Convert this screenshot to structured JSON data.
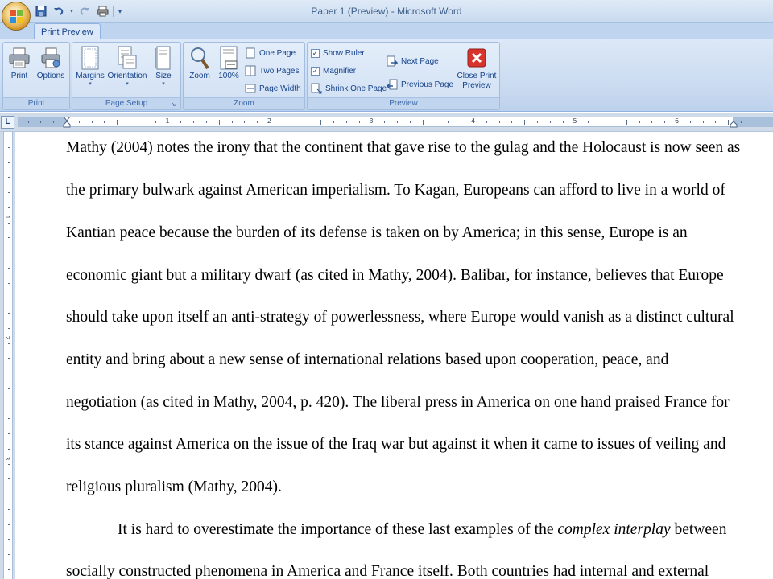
{
  "window": {
    "title": "Paper 1 (Preview) - Microsoft Word"
  },
  "tabs": {
    "active": "Print Preview"
  },
  "ribbon": {
    "print_group": {
      "label": "Print",
      "print": "Print",
      "options": "Options"
    },
    "page_setup_group": {
      "label": "Page Setup",
      "margins": "Margins",
      "orientation": "Orientation",
      "size": "Size"
    },
    "zoom_group": {
      "label": "Zoom",
      "zoom": "Zoom",
      "hundred": "100%",
      "one_page": "One Page",
      "two_pages": "Two Pages",
      "page_width": "Page Width"
    },
    "preview_group": {
      "label": "Preview",
      "show_ruler": "Show Ruler",
      "show_ruler_checked": true,
      "magnifier": "Magnifier",
      "magnifier_checked": true,
      "shrink_one_page": "Shrink One Page",
      "next_page": "Next Page",
      "previous_page": "Previous Page",
      "close_line1": "Close Print",
      "close_line2": "Preview"
    }
  },
  "ruler": {
    "corner": "L",
    "numbers": [
      "1",
      "2",
      "3",
      "4",
      "5",
      "6"
    ],
    "vertical_numbers": [
      "1",
      "2",
      "3"
    ]
  },
  "document": {
    "lines": [
      "Mathy (2004) notes the irony that the continent that gave rise to the gulag and the Holocaust is now seen as",
      "the primary bulwark against American imperialism.  To Kagan, Europeans can afford to live in a world of",
      "Kantian peace because the burden of its defense is taken on by America; in this sense, Europe is an",
      "economic giant but a military dwarf (as cited in Mathy, 2004).  Balibar, for instance, believes that Europe",
      "should take upon itself an anti-strategy of powerlessness, where Europe would vanish as a distinct cultural",
      "entity and bring about a new sense of international relations based upon cooperation, peace, and",
      "negotiation (as cited in Mathy, 2004, p. 420).  The liberal press in America on one hand praised France for",
      "its stance against America on the issue of the Iraq war but against it when it came to issues of veiling and",
      "religious pluralism (Mathy, 2004)."
    ],
    "para2_line1_before": "It is hard to overestimate the importance of these last examples of the ",
    "para2_line1_italic": "complex interplay",
    "para2_line1_after": " between",
    "para2_line2": "socially constructed phenomena in America and France itself.  Both countries had internal and external"
  },
  "colors": {
    "ribbon_text": "#15428b",
    "close_button": "#d9342b"
  }
}
